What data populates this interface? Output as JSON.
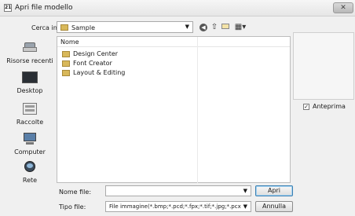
{
  "window": {
    "title": "Apri file modello",
    "app_icon_text": "21",
    "close_icon": "close-x-icon"
  },
  "lookin": {
    "label": "Cerca in:",
    "value": "Sample"
  },
  "toolbar": {
    "back_icon": "back-arrow-icon",
    "up_icon": "up-folder-icon",
    "new_folder_icon": "new-folder-icon",
    "view_menu_icon": "view-menu-icon"
  },
  "places": [
    {
      "label": "Risorse recenti",
      "icon": "recent-places-icon"
    },
    {
      "label": "Desktop",
      "icon": "desktop-icon"
    },
    {
      "label": "Raccolte",
      "icon": "libraries-icon"
    },
    {
      "label": "Computer",
      "icon": "computer-icon"
    },
    {
      "label": "Rete",
      "icon": "network-icon"
    }
  ],
  "filelist": {
    "column_name": "Nome",
    "items": [
      {
        "name": "Design Center",
        "icon": "folder-icon"
      },
      {
        "name": "Font Creator",
        "icon": "folder-icon"
      },
      {
        "name": "Layout & Editing",
        "icon": "folder-icon"
      }
    ]
  },
  "preview": {
    "label": "Anteprima",
    "checked": true
  },
  "filename": {
    "label": "Nome file:",
    "value": ""
  },
  "filetype": {
    "label": "Tipo file:",
    "value": "File immagine(*.bmp;*.pcd;*.fpx;*.tif;*.jpg;*.pcx;*.wmf;*.",
    "open_label": "Apri",
    "cancel_label": "Annulla"
  }
}
